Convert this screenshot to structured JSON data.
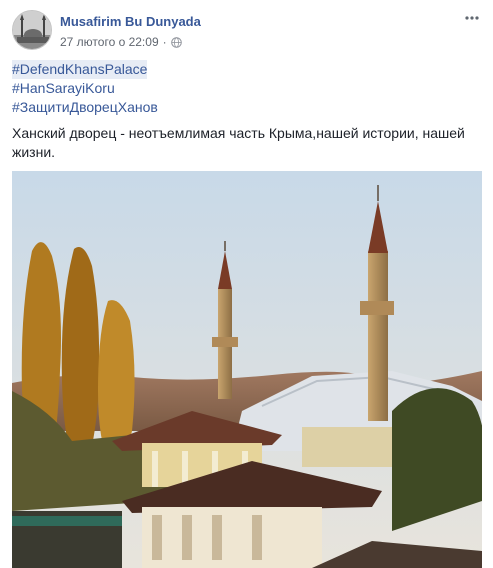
{
  "post": {
    "author": "Musafirim Bu Dunyada",
    "timestamp": "27 лютого о 22:09",
    "separator": "·",
    "privacy_icon": "globe-icon",
    "menu_icon": "more-options-icon",
    "hashtags": [
      "#DefendKhansPalace",
      "#HanSarayiKoru",
      "#ЗащитиДворецХанов"
    ],
    "message": "Ханский дворец - неотъемлимая часть Крыма,нашей истории, нашей жизни.",
    "photo_subject": "Khan's Palace minarets at sunset"
  },
  "colors": {
    "link": "#385898",
    "text": "#1d2129",
    "meta": "#616770",
    "hashtag_highlight": "#e7ecf5"
  }
}
